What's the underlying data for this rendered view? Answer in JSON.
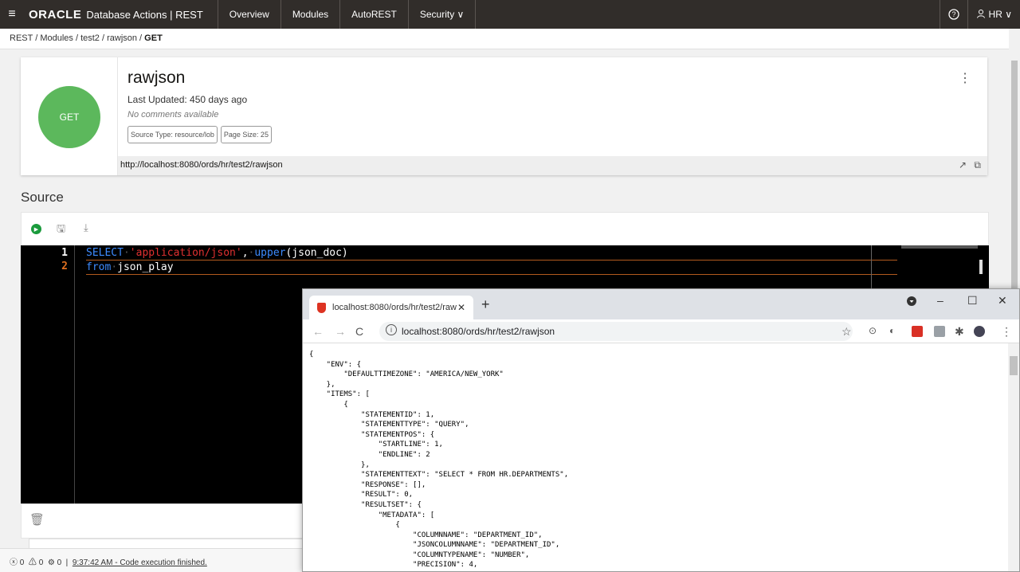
{
  "topbar": {
    "menu_icon": "hamburger-icon",
    "logo": "ORACLE",
    "app_name": "Database Actions | REST",
    "nav": [
      "Overview",
      "Modules",
      "AutoREST",
      "Security ∨"
    ],
    "help_icon": "help-icon",
    "user": "HR ∨"
  },
  "breadcrumb": {
    "items": [
      "REST",
      "Modules",
      "test2",
      "rawjson"
    ],
    "current": "GET",
    "separator": " / "
  },
  "card": {
    "method": "GET",
    "method_color": "#5cb85c",
    "title": "rawjson",
    "last_updated": "Last Updated: 450 days ago",
    "comments": "No comments available",
    "tags": [
      "Source Type: resource/lob",
      "Page Size: 25"
    ],
    "url": "http://localhost:8080/ords/hr/test2/rawjson"
  },
  "source": {
    "title": "Source",
    "toolbar_icons": [
      "run-icon",
      "save-icon",
      "download-icon"
    ]
  },
  "editor": {
    "lines": [
      {
        "num": "1",
        "tokens": [
          {
            "t": "SELECT",
            "c": "#3d8bff"
          },
          {
            "t": "·",
            "c": "#555"
          },
          {
            "t": "'application/json'",
            "c": "#e03030"
          },
          {
            "t": ",",
            "c": "#ffffff"
          },
          {
            "t": "·",
            "c": "#555"
          },
          {
            "t": "upper",
            "c": "#3d8bff"
          },
          {
            "t": "(json_doc)",
            "c": "#ffffff"
          }
        ]
      },
      {
        "num": "2",
        "tokens": [
          {
            "t": "from",
            "c": "#3d8bff"
          },
          {
            "t": "·",
            "c": "#555"
          },
          {
            "t": "json_play",
            "c": "#ffffff"
          }
        ]
      }
    ],
    "line_number_colors": [
      "#ffffff",
      "#e07020"
    ]
  },
  "status": {
    "errors": "0",
    "warnings": "0",
    "info": "0",
    "message": "9:37:42 AM - Code execution finished."
  },
  "browser": {
    "tab_title": "localhost:8080/ords/hr/test2/raw",
    "address": "localhost:8080/ords/hr/test2/rawjson",
    "json_lines": [
      "{",
      "    \"ENV\": {",
      "        \"DEFAULTTIMEZONE\": \"AMERICA/NEW_YORK\"",
      "    },",
      "    \"ITEMS\": [",
      "        {",
      "            \"STATEMENTID\": 1,",
      "            \"STATEMENTTYPE\": \"QUERY\",",
      "            \"STATEMENTPOS\": {",
      "                \"STARTLINE\": 1,",
      "                \"ENDLINE\": 2",
      "            },",
      "            \"STATEMENTTEXT\": \"SELECT * FROM HR.DEPARTMENTS\",",
      "            \"RESPONSE\": [],",
      "            \"RESULT\": 0,",
      "            \"RESULTSET\": {",
      "                \"METADATA\": [",
      "                    {",
      "                        \"COLUMNNAME\": \"DEPARTMENT_ID\",",
      "                        \"JSONCOLUMNNAME\": \"DEPARTMENT_ID\",",
      "                        \"COLUMNTYPENAME\": \"NUMBER\",",
      "                        \"PRECISION\": 4,"
    ]
  }
}
